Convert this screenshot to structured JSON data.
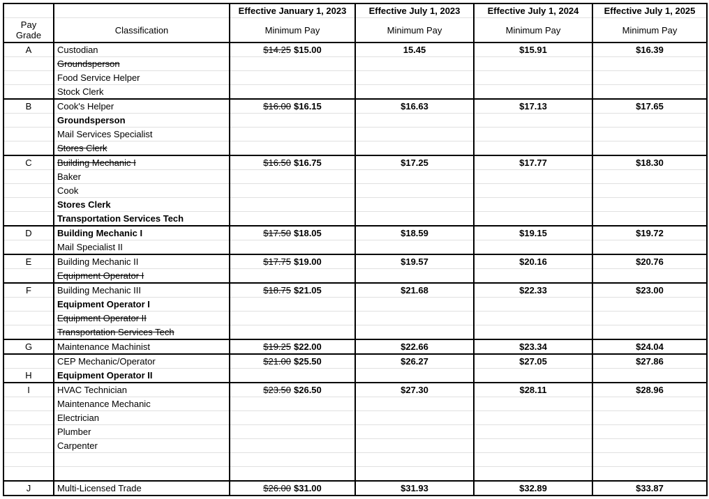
{
  "headers": {
    "paygrade": "Pay Grade",
    "classification": "Classification",
    "minpay": "Minimum Pay",
    "p1": "Effective January 1, 2023",
    "p2": "Effective July 1, 2023",
    "p3": "Effective July 1, 2024",
    "p4": "Effective July 1, 2025"
  },
  "groups": [
    {
      "grade": "A",
      "rows": [
        {
          "label": "Custodian",
          "bold": false,
          "strike": false,
          "old": "$14.25",
          "new": "$15.00",
          "p2": "15.45",
          "p3": "$15.91",
          "p4": "$16.39"
        },
        {
          "label": "Groundsperson",
          "bold": false,
          "strike": true
        },
        {
          "label": "Food Service Helper",
          "bold": false,
          "strike": false
        },
        {
          "label": "Stock Clerk",
          "bold": false,
          "strike": false
        }
      ]
    },
    {
      "grade": "B",
      "rows": [
        {
          "label": "Cook's Helper",
          "bold": false,
          "strike": false,
          "old": "$16.00",
          "new": "$16.15",
          "p2": "$16.63",
          "p3": "$17.13",
          "p4": "$17.65"
        },
        {
          "label": "Groundsperson",
          "bold": true,
          "strike": false
        },
        {
          "label": "Mail Services Specialist",
          "bold": false,
          "strike": false
        },
        {
          "label": "Stores Clerk",
          "bold": false,
          "strike": true
        }
      ]
    },
    {
      "grade": "C",
      "rows": [
        {
          "label": "Building Mechanic I",
          "bold": false,
          "strike": true,
          "old": "$16.50",
          "new": "$16.75",
          "p2": "$17.25",
          "p3": "$17.77",
          "p4": "$18.30"
        },
        {
          "label": "Baker",
          "bold": false,
          "strike": false
        },
        {
          "label": "Cook",
          "bold": false,
          "strike": false
        },
        {
          "label": "Stores Clerk",
          "bold": true,
          "strike": false
        },
        {
          "label": "Transportation Services Tech",
          "bold": true,
          "strike": false
        }
      ]
    },
    {
      "grade": "D",
      "rows": [
        {
          "label": "Building Mechanic I",
          "bold": true,
          "strike": false,
          "old": "$17.50",
          "new": "$18.05",
          "p2": "$18.59",
          "p3": "$19.15",
          "p4": "$19.72"
        },
        {
          "label": "Mail Specialist II",
          "bold": false,
          "strike": false
        }
      ]
    },
    {
      "grade": "E",
      "rows": [
        {
          "label": "Building Mechanic II",
          "bold": false,
          "strike": false,
          "old": "$17.75",
          "new": "$19.00",
          "p2": "$19.57",
          "p3": "$20.16",
          "p4": "$20.76"
        },
        {
          "label": "Equipment Operator I",
          "bold": false,
          "strike": true
        }
      ]
    },
    {
      "grade": "F",
      "rows": [
        {
          "label": "Building Mechanic III",
          "bold": false,
          "strike": false,
          "old": "$18.75",
          "new": "$21.05",
          "p2": "$21.68",
          "p3": "$22.33",
          "p4": "$23.00"
        },
        {
          "label": "Equipment Operator I",
          "bold": true,
          "strike": false
        },
        {
          "label": "Equipment Operator II",
          "bold": false,
          "strike": true
        },
        {
          "label": "Transportation Services Tech",
          "bold": false,
          "strike": true
        }
      ]
    },
    {
      "grade": "G",
      "rows": [
        {
          "label": "Maintenance Machinist",
          "bold": false,
          "strike": false,
          "old": "$19.25",
          "new": "$22.00",
          "p2": "$22.66",
          "p3": "$23.34",
          "p4": "$24.04"
        }
      ]
    },
    {
      "grade": "H",
      "grade_row_index": 1,
      "rows": [
        {
          "label": "CEP Mechanic/Operator",
          "bold": false,
          "strike": false,
          "old": "$21.00",
          "new": "$25.50",
          "p2": "$26.27",
          "p3": "$27.05",
          "p4": "$27.86"
        },
        {
          "label": "Equipment Operator II",
          "bold": true,
          "strike": false
        }
      ]
    },
    {
      "grade": "I",
      "rows": [
        {
          "label": "HVAC Technician",
          "bold": false,
          "strike": false,
          "old": "$23.50",
          "new": "$26.50",
          "p2": "$27.30",
          "p3": "$28.11",
          "p4": "$28.96"
        },
        {
          "label": "Maintenance Mechanic",
          "bold": false,
          "strike": false
        },
        {
          "label": "Electrician",
          "bold": false,
          "strike": false
        },
        {
          "label": "Plumber",
          "bold": false,
          "strike": false
        },
        {
          "label": "Carpenter",
          "bold": false,
          "strike": false
        },
        {
          "label": "",
          "bold": false,
          "strike": false
        },
        {
          "label": "",
          "bold": false,
          "strike": false
        }
      ]
    },
    {
      "grade": "J",
      "last": true,
      "rows": [
        {
          "label": "Multi-Licensed Trade",
          "bold": false,
          "strike": false,
          "old": "$26.00",
          "new": "$31.00",
          "p2": "$31.93",
          "p3": "$32.89",
          "p4": "$33.87"
        }
      ]
    }
  ]
}
